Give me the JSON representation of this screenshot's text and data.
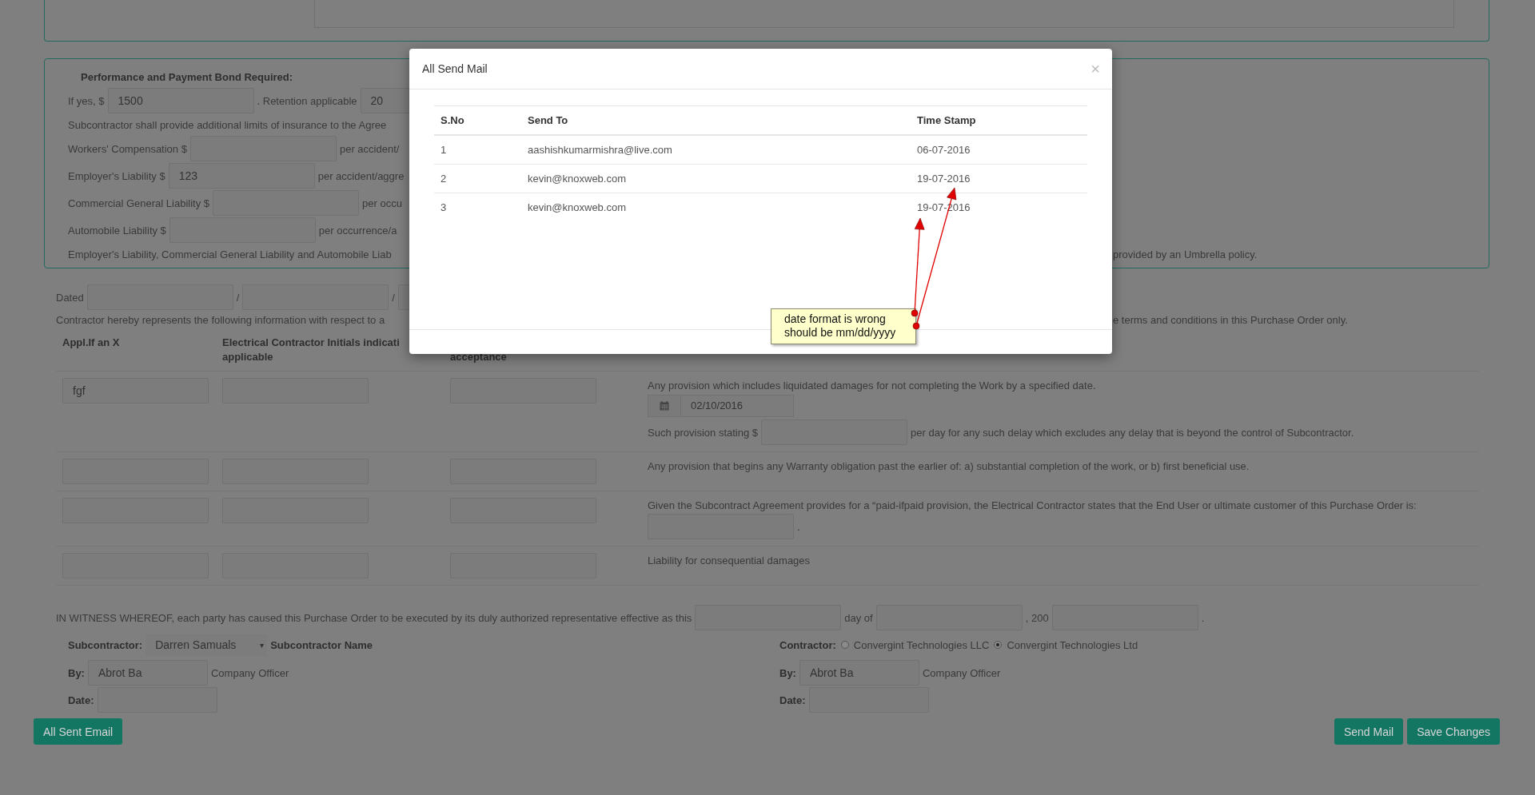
{
  "bond_panel": {
    "title": "Performance and Payment Bond Required:",
    "rows": [
      {
        "items": [
          {
            "kind": "text",
            "text": "If yes, $"
          },
          {
            "kind": "input",
            "value": "1500"
          },
          {
            "kind": "text",
            "text": ". Retention applicable"
          },
          {
            "kind": "input",
            "value": "20"
          }
        ]
      },
      {
        "items": [
          {
            "kind": "text",
            "text": "Subcontractor shall provide additional limits of insurance to the Agree"
          }
        ]
      },
      {
        "items": [
          {
            "kind": "text",
            "text": "Workers' Compensation $"
          },
          {
            "kind": "input"
          },
          {
            "kind": "text",
            "text": "per accident/"
          }
        ]
      },
      {
        "items": [
          {
            "kind": "text",
            "text": "Employer's Liability $"
          },
          {
            "kind": "input",
            "value": "123"
          },
          {
            "kind": "text",
            "text": "per accident/aggre"
          }
        ]
      },
      {
        "items": [
          {
            "kind": "text",
            "text": "Commercial General Liability $"
          },
          {
            "kind": "input"
          },
          {
            "kind": "text",
            "text": "per occu"
          }
        ]
      },
      {
        "items": [
          {
            "kind": "text",
            "text": "Automobile Liability $"
          },
          {
            "kind": "input"
          },
          {
            "kind": "text",
            "text": "per occurrence/a"
          }
        ]
      },
      {
        "items": [
          {
            "kind": "text",
            "text": "Employer's Liability, Commercial General Liability and Automobile Liab"
          }
        ],
        "tail": "provided by an Umbrella policy."
      }
    ]
  },
  "dated_row": {
    "items": [
      {
        "kind": "text",
        "text": "Dated"
      },
      {
        "kind": "input"
      },
      {
        "kind": "text",
        "text": "/"
      },
      {
        "kind": "input"
      },
      {
        "kind": "text",
        "text": "/"
      },
      {
        "kind": "input"
      }
    ]
  },
  "contractor_line": {
    "items": [
      {
        "kind": "text",
        "text": "Contractor hereby represents the following information with respect to a"
      }
    ],
    "tail": "e terms and conditions in this Purchase Order only."
  },
  "provisions_table": {
    "columns": [
      {
        "lines": [
          "Appl.If an X"
        ]
      },
      {
        "lines": [
          "Electrical Contractor Initials indicati",
          "applicable"
        ]
      },
      {
        "lines": [
          "acceptance"
        ]
      }
    ],
    "rows": [
      {
        "appl": "fgf",
        "lines": [
          [
            {
              "kind": "text",
              "text": "Any provision which includes liquidated damages for not completing the Work by a specified date."
            }
          ],
          [
            {
              "kind": "date",
              "value": "02/10/2016"
            }
          ],
          [
            {
              "kind": "text",
              "text": "Such provision stating $"
            },
            {
              "kind": "input"
            },
            {
              "kind": "text",
              "text": "per day for any such delay which excludes any delay that is beyond the control of Subcontractor."
            }
          ]
        ]
      },
      {
        "lines": [
          [
            {
              "kind": "text",
              "text": "Any provision that begins any Warranty obligation past the earlier of: a) substantial completion of the work, or b) first beneficial use."
            }
          ]
        ]
      },
      {
        "lines": [
          [
            {
              "kind": "text",
              "text": "Given the Subcontract Agreement provides for a “paid-ifpaid provision, the Electrical Contractor states that the End User or ultimate customer of this Purchase Order is:"
            }
          ],
          [
            {
              "kind": "input"
            },
            {
              "kind": "text",
              "text": "."
            }
          ]
        ]
      },
      {
        "lines": [
          [
            {
              "kind": "text",
              "text": "Liability for consequential damages"
            }
          ]
        ]
      }
    ]
  },
  "witness_row": {
    "items": [
      {
        "kind": "text",
        "text": "IN WITNESS WHEREOF, each party has caused this Purchase Order to be executed by its duly authorized representative effective as this"
      },
      {
        "kind": "input"
      },
      {
        "kind": "text",
        "text": "day of"
      },
      {
        "kind": "input"
      },
      {
        "kind": "text",
        "text": ", 200"
      },
      {
        "kind": "input"
      },
      {
        "kind": "text",
        "text": "."
      }
    ]
  },
  "subcontractor": {
    "label": "Subcontractor:",
    "select": "Darren Samuals",
    "caret": "▾",
    "name_label": "Subcontractor Name",
    "by_label": "By:",
    "by_value": "Abrot Ba",
    "by_note": "Company Officer",
    "date_label": "Date:"
  },
  "contractor": {
    "label": "Contractor:",
    "options": [
      {
        "label": "Convergint Technologies LLC",
        "selected": false
      },
      {
        "label": "Convergint Technologies Ltd",
        "selected": true
      }
    ],
    "by_label": "By:",
    "by_value": "Abrot Ba",
    "by_note": "Company Officer",
    "date_label": "Date:"
  },
  "buttons_left": [
    "All Sent Email"
  ],
  "buttons_right": [
    "Send Mail",
    "Save Changes"
  ],
  "modal": {
    "title": "All Send Mail",
    "close": "×",
    "columns": [
      "S.No",
      "Send To",
      "Time Stamp"
    ],
    "rows": [
      [
        "1",
        "aashishkumarmishra@live.com",
        "06-07-2016"
      ],
      [
        "2",
        "kevin@knoxweb.com",
        "19-07-2016"
      ],
      [
        "3",
        "kevin@knoxweb.com",
        "19-07-2016"
      ]
    ]
  },
  "annotation": {
    "lines": [
      "date format is wrong",
      "should be mm/dd/yyyy"
    ]
  }
}
